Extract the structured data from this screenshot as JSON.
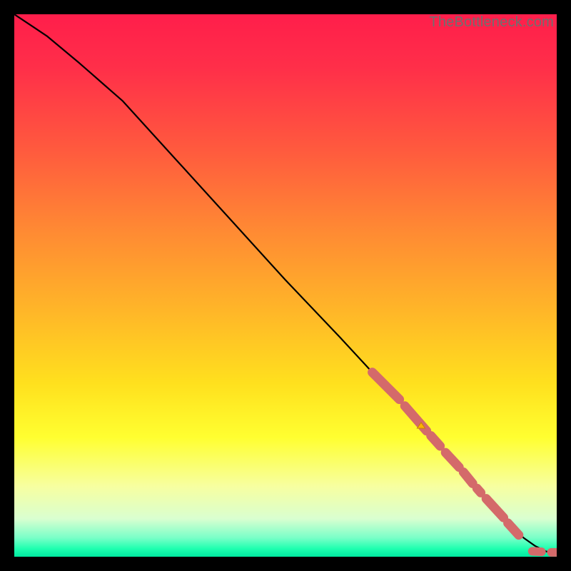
{
  "watermark": "TheBottleneck.com",
  "colors": {
    "gradient_stops": [
      {
        "offset": 0.0,
        "color": "#ff1e4b"
      },
      {
        "offset": 0.1,
        "color": "#ff2f49"
      },
      {
        "offset": 0.25,
        "color": "#ff5a3e"
      },
      {
        "offset": 0.4,
        "color": "#ff8a33"
      },
      {
        "offset": 0.55,
        "color": "#ffb728"
      },
      {
        "offset": 0.68,
        "color": "#ffe01e"
      },
      {
        "offset": 0.78,
        "color": "#ffff30"
      },
      {
        "offset": 0.87,
        "color": "#f7ffa0"
      },
      {
        "offset": 0.93,
        "color": "#d9ffd0"
      },
      {
        "offset": 0.965,
        "color": "#7affc8"
      },
      {
        "offset": 0.985,
        "color": "#1fffb0"
      },
      {
        "offset": 1.0,
        "color": "#00e8a0"
      }
    ],
    "curve": "#000000",
    "marker_fill": "#d46a6a",
    "marker_stroke": "#b55050"
  },
  "chart_data": {
    "type": "line",
    "title": "",
    "xlabel": "",
    "ylabel": "",
    "xlim": [
      0,
      100
    ],
    "ylim": [
      0,
      100
    ],
    "series": [
      {
        "name": "curve",
        "x": [
          0,
          3,
          6,
          9,
          12,
          16,
          20,
          30,
          40,
          50,
          60,
          66,
          70,
          74,
          78,
          82,
          86,
          88,
          90,
          92,
          94,
          96,
          98,
          99,
          100
        ],
        "y": [
          100,
          98,
          96,
          93.5,
          91,
          87.5,
          84,
          73,
          62,
          51,
          40.5,
          34,
          30,
          25.5,
          21,
          16.5,
          12,
          9.5,
          7.2,
          5.2,
          3.4,
          2.0,
          1.0,
          0.7,
          0.6
        ]
      }
    ],
    "marker_segments": [
      {
        "x0": 66.0,
        "y0": 34.0,
        "x1": 71.0,
        "y1": 29.0
      },
      {
        "x0": 72.0,
        "y0": 27.8,
        "x1": 76.0,
        "y1": 23.2
      },
      {
        "x0": 76.8,
        "y0": 22.3,
        "x1": 78.5,
        "y1": 20.4
      },
      {
        "x0": 79.5,
        "y0": 19.2,
        "x1": 82.0,
        "y1": 16.5
      },
      {
        "x0": 82.8,
        "y0": 15.6,
        "x1": 84.5,
        "y1": 13.5
      },
      {
        "x0": 85.3,
        "y0": 12.6,
        "x1": 86.0,
        "y1": 11.8
      },
      {
        "x0": 87.0,
        "y0": 10.7,
        "x1": 90.2,
        "y1": 7.2
      },
      {
        "x0": 91.0,
        "y0": 6.2,
        "x1": 93.0,
        "y1": 4.0
      }
    ],
    "bottom_marker_segments": [
      {
        "x0": 95.5,
        "y0": 1.0,
        "x1": 97.2,
        "y1": 0.9
      },
      {
        "x0": 99.0,
        "y0": 0.8,
        "x1": 100.0,
        "y1": 0.8
      }
    ],
    "arrow_marker": {
      "x": 75.0,
      "y": 25.0
    }
  }
}
